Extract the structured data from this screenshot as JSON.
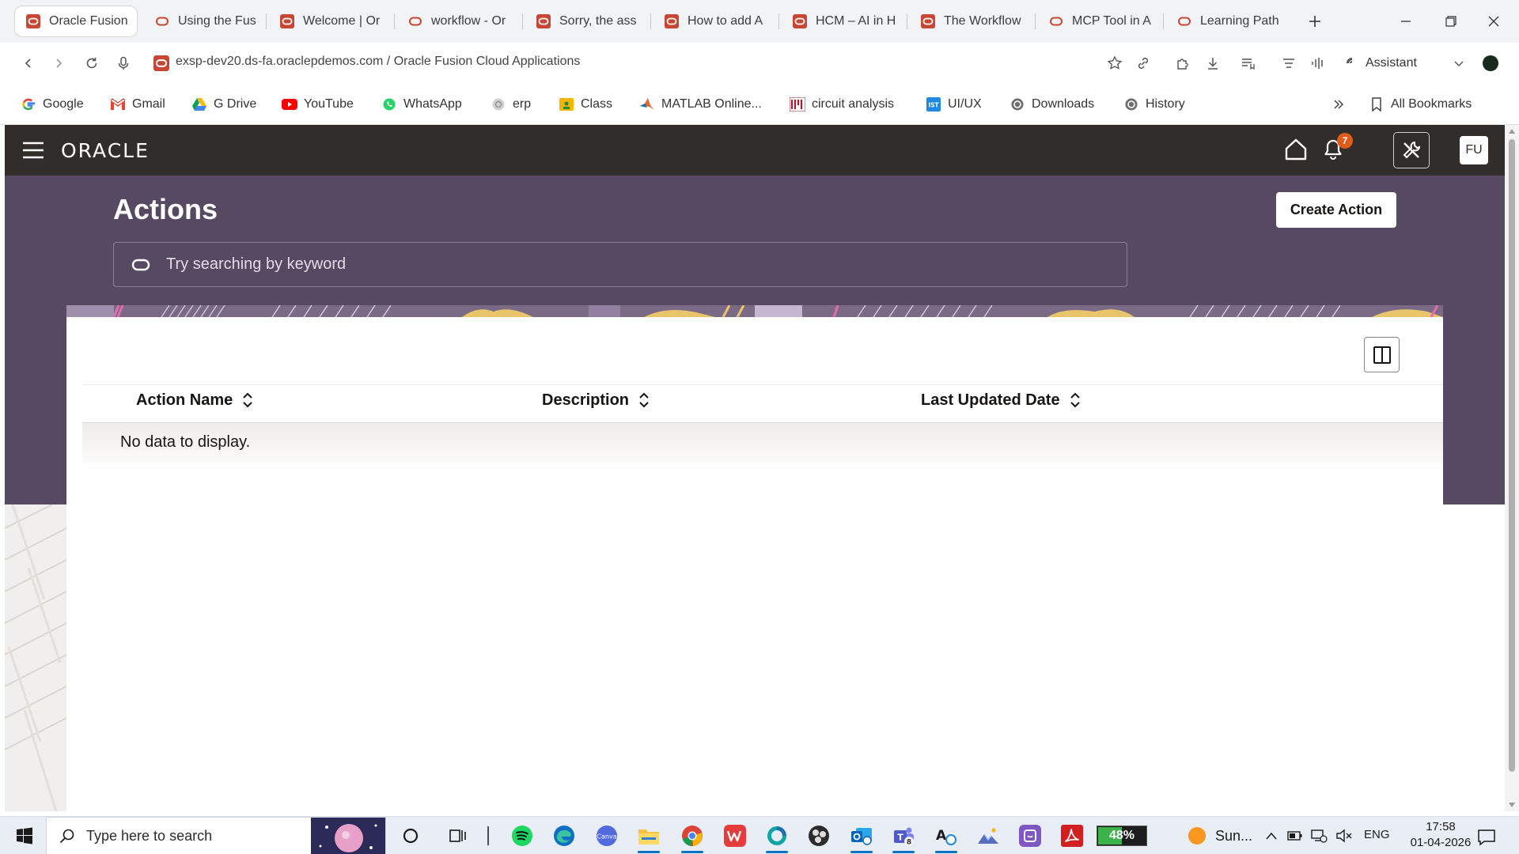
{
  "browser": {
    "tabs": [
      {
        "label": "Oracle Fusion",
        "active": true
      },
      {
        "label": "Using the Fus"
      },
      {
        "label": "Welcome | Or"
      },
      {
        "label": "workflow - Or"
      },
      {
        "label": "Sorry, the ass"
      },
      {
        "label": "How to add A"
      },
      {
        "label": "HCM – AI in H"
      },
      {
        "label": "The Workflow"
      },
      {
        "label": "MCP Tool in A"
      },
      {
        "label": "Learning Path"
      }
    ],
    "url": "exsp-dev20.ds-fa.oraclepdemos.com / Oracle Fusion Cloud Applications",
    "assistant_label": "Assistant",
    "bookmarks": [
      {
        "label": "Google",
        "icon": "google-icon"
      },
      {
        "label": "Gmail",
        "icon": "gmail-icon"
      },
      {
        "label": "G Drive",
        "icon": "drive-icon"
      },
      {
        "label": "YouTube",
        "icon": "youtube-icon"
      },
      {
        "label": "WhatsApp",
        "icon": "whatsapp-icon"
      },
      {
        "label": "erp",
        "icon": "globe-icon"
      },
      {
        "label": "Class",
        "icon": "classroom-icon"
      },
      {
        "label": "MATLAB Online...",
        "icon": "matlab-icon"
      },
      {
        "label": "circuit analysis",
        "icon": "mit-icon"
      },
      {
        "label": "UI/UX",
        "icon": "ist-icon"
      },
      {
        "label": "Downloads",
        "icon": "history-icon"
      },
      {
        "label": "History",
        "icon": "history-icon"
      }
    ],
    "all_bookmarks_label": "All Bookmarks"
  },
  "oracle": {
    "logo_text": "ORACLE",
    "notification_count": "7",
    "user_initials": "FU",
    "page_title": "Actions",
    "create_button_label": "Create Action",
    "search_placeholder": "Try searching by keyword",
    "columns": [
      {
        "label": "Action Name"
      },
      {
        "label": "Description"
      },
      {
        "label": "Last Updated Date"
      }
    ],
    "empty_message": "No data to display.",
    "colors": {
      "header": "#312d2a",
      "hero": "#584963"
    }
  },
  "taskbar": {
    "search_placeholder": "Type here to search",
    "battery": "48%",
    "weather": "Sun...",
    "language": "ENG",
    "time": "17:58",
    "date": "01-04-2026"
  }
}
